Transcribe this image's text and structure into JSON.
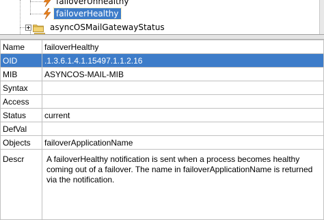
{
  "tree": {
    "items": [
      {
        "label": "failoverUnhealthy",
        "icon": "notification-icon"
      },
      {
        "label": "failoverHealthy",
        "icon": "notification-icon",
        "selected": true
      },
      {
        "label": "asyncOSMailGatewayStatus",
        "icon": "folder-icon"
      }
    ]
  },
  "properties": {
    "rows": [
      {
        "key": "Name",
        "value": "failoverHealthy"
      },
      {
        "key": "OID",
        "value": ".1.3.6.1.4.1.15497.1.1.2.16",
        "selected": true
      },
      {
        "key": "MIB",
        "value": "ASYNCOS-MAIL-MIB"
      },
      {
        "key": "Syntax",
        "value": ""
      },
      {
        "key": "Access",
        "value": ""
      },
      {
        "key": "Status",
        "value": "current"
      },
      {
        "key": "DefVal",
        "value": ""
      },
      {
        "key": "Objects",
        "value": "failoverApplicationName"
      },
      {
        "key": "Descr",
        "value": "A failoverHealthy notification is sent when a process becomes healthy coming out of a failover. The name in failoverApplicationName is returned via the notification."
      }
    ]
  },
  "colors": {
    "selection": "#3d7cc9",
    "notification_icon": "#e8821e",
    "folder": "#e9c25a"
  }
}
